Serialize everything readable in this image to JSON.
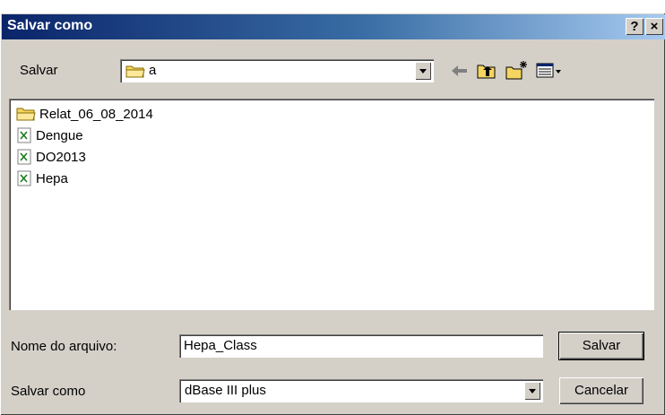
{
  "window": {
    "title": "Salvar como",
    "help_label": "?",
    "close_label": "×"
  },
  "location": {
    "label": "Salvar",
    "current_folder": "a"
  },
  "files": [
    {
      "name": "Relat_06_08_2014",
      "type": "folder"
    },
    {
      "name": "Dengue",
      "type": "file"
    },
    {
      "name": "DO2013",
      "type": "file"
    },
    {
      "name": "Hepa",
      "type": "file"
    }
  ],
  "filename": {
    "label": "Nome do arquivo:",
    "value": "Hepa_Class"
  },
  "filetype": {
    "label": "Salvar como",
    "value": "dBase III plus"
  },
  "buttons": {
    "save_label": "Salvar",
    "cancel_label": "Cancelar"
  },
  "colors": {
    "titlebar_start": "#0a246a",
    "titlebar_end": "#a6caf0",
    "dialog_bg": "#d4d0c8"
  }
}
